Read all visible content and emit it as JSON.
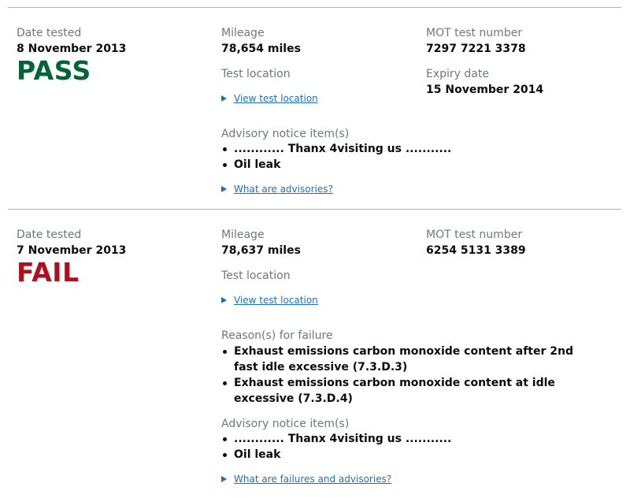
{
  "tests": [
    {
      "date_label": "Date tested",
      "date": "8 November 2013",
      "result": "PASS",
      "mileage_label": "Mileage",
      "mileage": "78,654 miles",
      "location_label": "Test location",
      "location_link": "View test location",
      "test_number_label": "MOT test number",
      "test_number": "7297 7221 3378",
      "expiry_label": "Expiry date",
      "expiry": "15 November 2014",
      "advisory_label": "Advisory notice item(s)",
      "advisories": [
        "............ Thanx 4visiting us ...........",
        "Oil leak"
      ],
      "help_link": "What are advisories?"
    },
    {
      "date_label": "Date tested",
      "date": "7 November 2013",
      "result": "FAIL",
      "mileage_label": "Mileage",
      "mileage": "78,637 miles",
      "location_label": "Test location",
      "location_link": "View test location",
      "test_number_label": "MOT test number",
      "test_number": "6254 5131 3389",
      "failure_label": "Reason(s) for failure",
      "failures": [
        "Exhaust emissions carbon monoxide content after 2nd fast idle excessive (7.3.D.3)",
        "Exhaust emissions carbon monoxide content at idle excessive (7.3.D.4)"
      ],
      "advisory_label": "Advisory notice item(s)",
      "advisories": [
        "............ Thanx 4visiting us ...........",
        "Oil leak"
      ],
      "help_link": "What are failures and advisories?"
    }
  ],
  "colors": {
    "pass": "#006435",
    "fail": "#b10e1e",
    "link": "#1d70b8",
    "label": "#6f777b"
  },
  "icons": {
    "details_toggle": "triangle-right-icon"
  }
}
